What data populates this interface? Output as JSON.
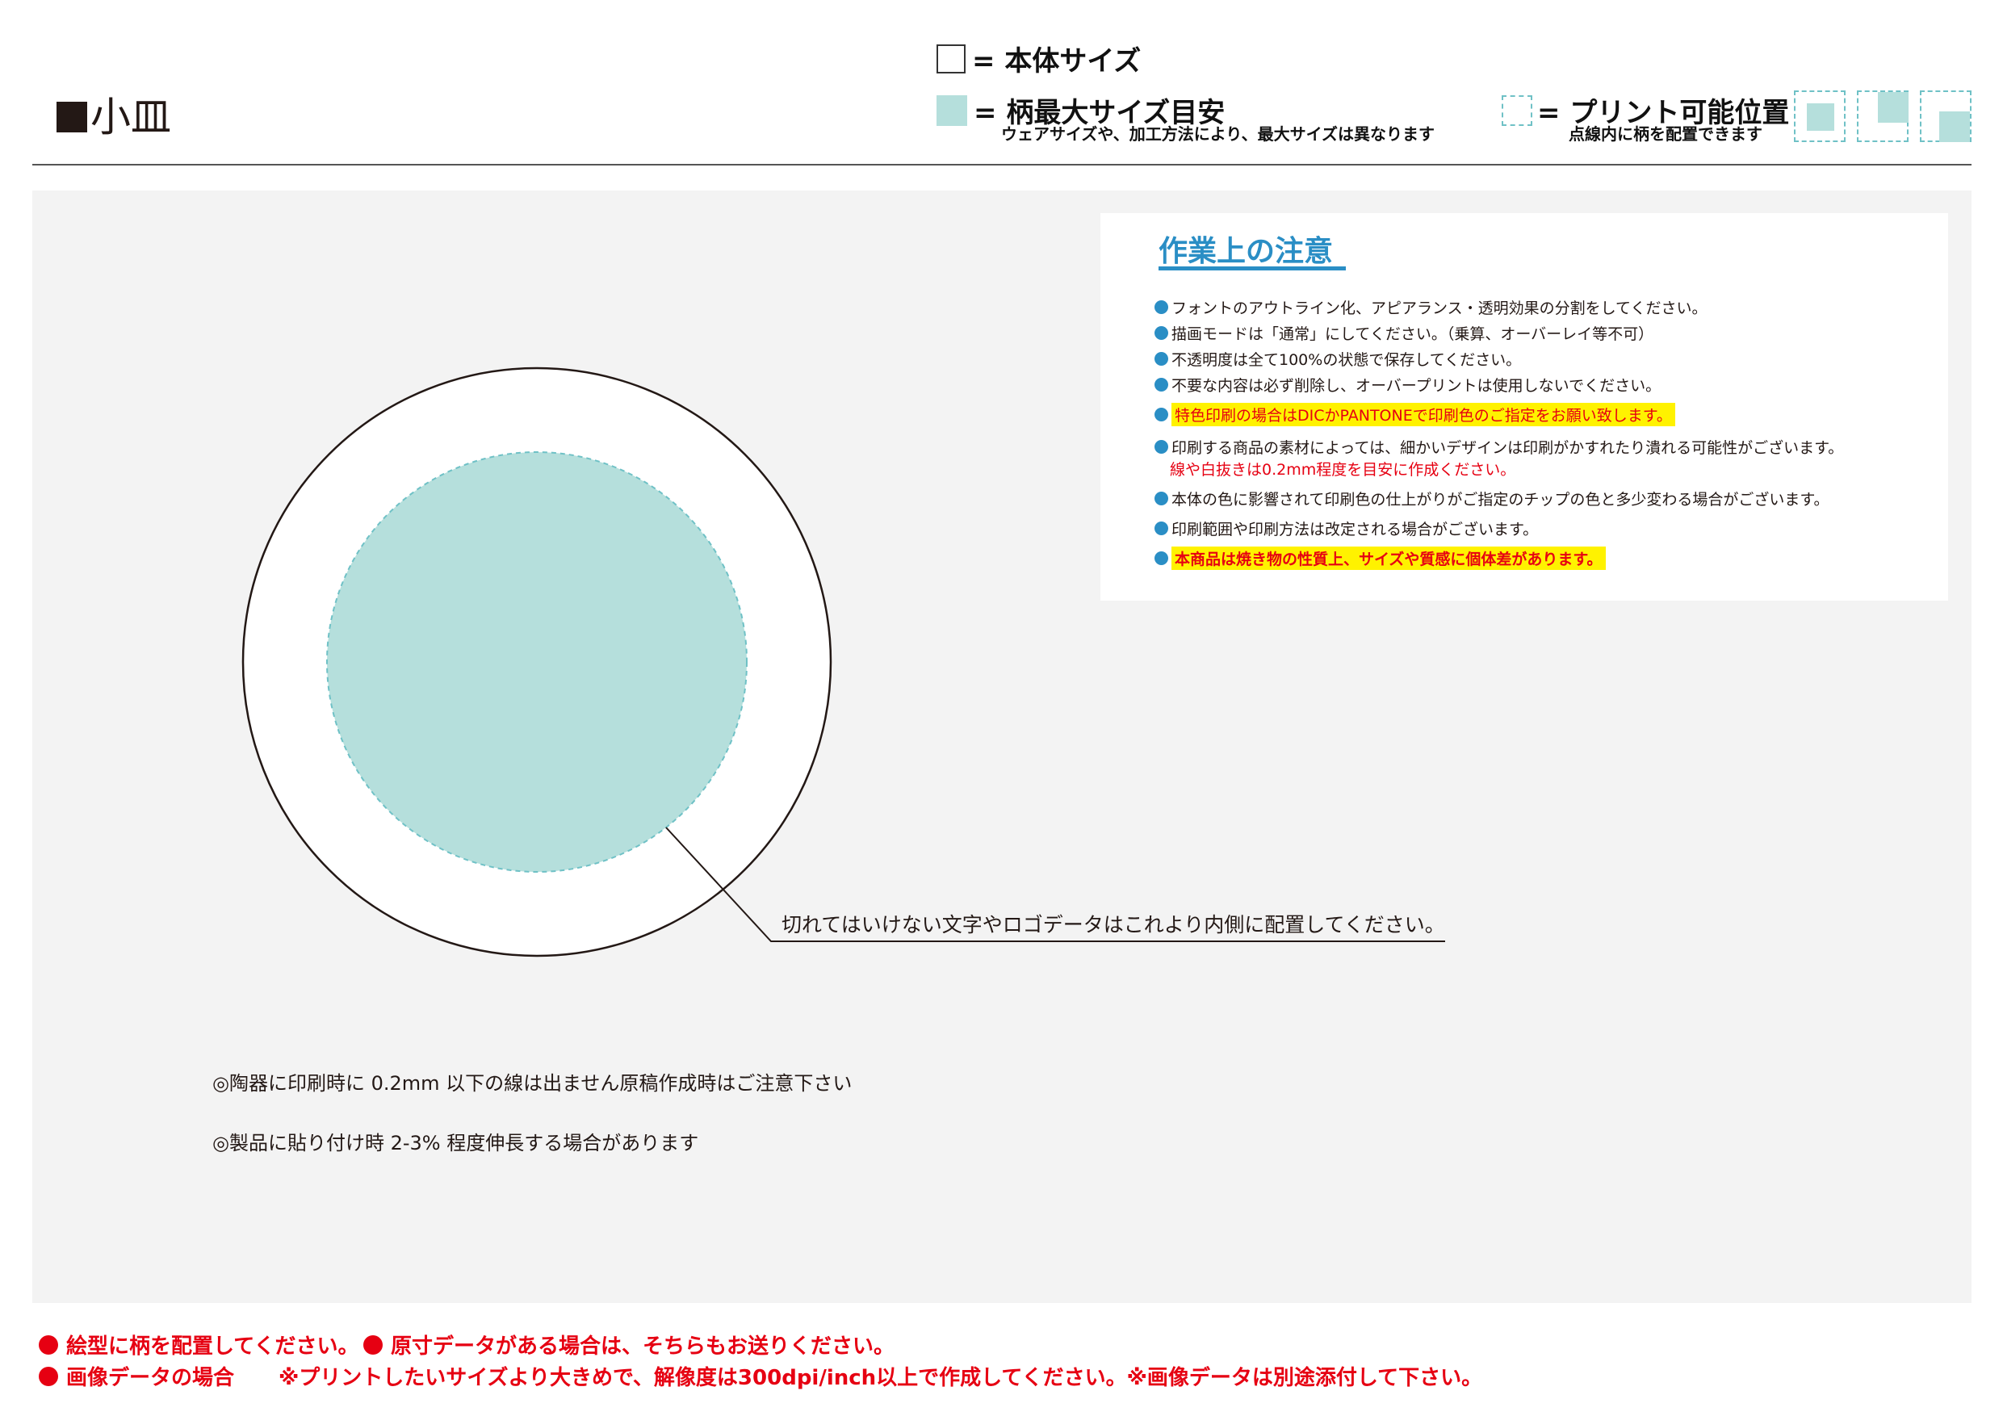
{
  "header": {
    "title": "小皿"
  },
  "legend": {
    "body_size_label": "= 本体サイズ",
    "max_pattern_label": "= 柄最大サイズ目安",
    "max_pattern_note": "ウェアサイズや、加工方法により、最大サイズは異なります",
    "printable_label": "= プリント可能位置",
    "printable_note": "点線内に柄を配置できます"
  },
  "leader_note": "切れてはいけない文字やロゴデータはこれより内側に配置してください。",
  "notes": [
    "◎陶器に印刷時に 0.2mm 以下の線は出ません原稿作成時はご注意下さい",
    "◎製品に貼り付け時 2-3% 程度伸長する場合があります"
  ],
  "caution": {
    "title": "作業上の注意",
    "items": [
      "フォントのアウトライン化、アピアランス・透明効果の分割をしてください。",
      "描画モードは「通常」にしてください。（乗算、オーバーレイ等不可）",
      "不透明度は全て100%の状態で保存してください。",
      "不要な内容は必ず削除し、オーバープリントは使用しないでください。",
      "特色印刷の場合はDICかPANTONEで印刷色のご指定をお願い致します。",
      "印刷する商品の素材によっては、細かいデザインは印刷がかすれたり潰れる可能性がございます。",
      "本体の色に影響されて印刷色の仕上がりがご指定のチップの色と多少変わる場合がございます。",
      "印刷範囲や印刷方法は改定される場合がございます。",
      "本商品は焼き物の性質上、サイズや質感に個体差があります。"
    ],
    "item_6_sub": "線や白抜きは0.2mm程度を目安に作成ください。"
  },
  "footer": {
    "item1": "絵型に柄を配置してください。",
    "item2": "原寸データがある場合は、そちらもお送りください。",
    "item3_head": "画像データの場合",
    "item3_body": "※プリントしたいサイズより大きめで、解像度は300dpi/inch以上で作成してください。※画像データは別途添付して下さい。"
  },
  "colors": {
    "max_pattern_fill": "#b5dfdc",
    "printable_dash": "#6fc1c6",
    "caution_blue": "#2a8ec5",
    "warning_red": "#e60012",
    "highlight_yellow": "#fff200"
  }
}
